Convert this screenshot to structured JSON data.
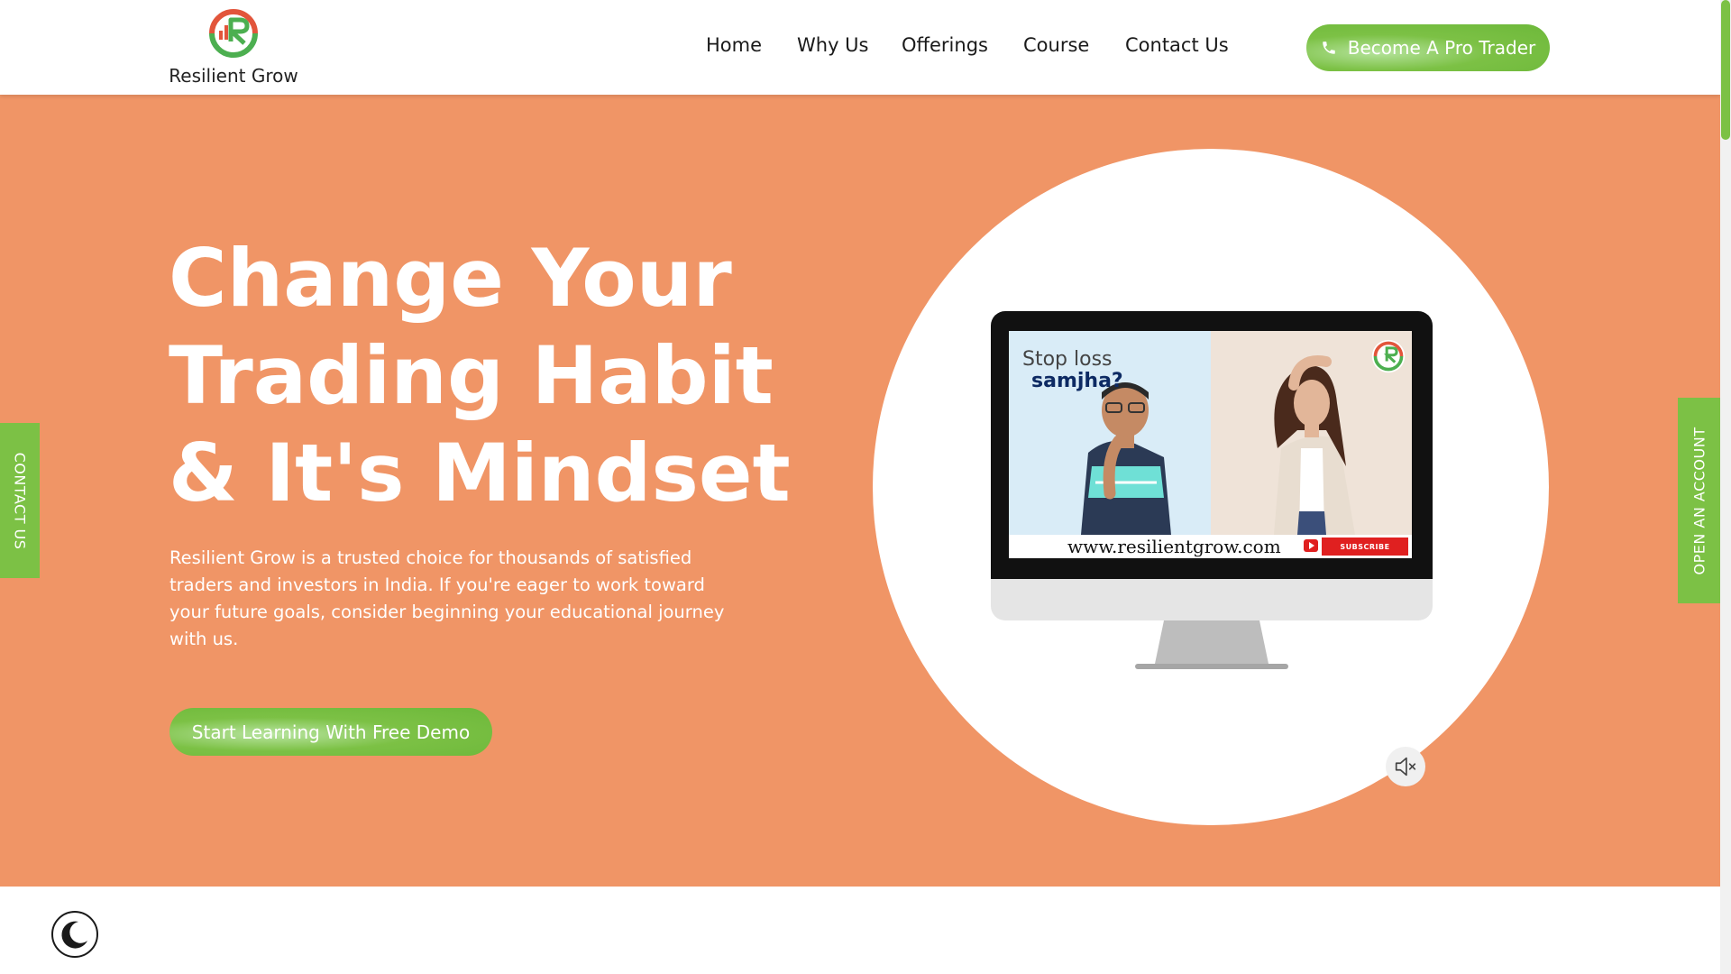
{
  "header": {
    "brand": "Resilient Grow",
    "nav": [
      {
        "label": "Home"
      },
      {
        "label": "Why Us"
      },
      {
        "label": "Offerings"
      },
      {
        "label": "Course"
      },
      {
        "label": "Contact Us"
      }
    ],
    "cta_label": "Become A Pro Trader"
  },
  "hero": {
    "title_lines": [
      "Change Your",
      "Trading Habit",
      "& It's Mindset"
    ],
    "description": "Resilient Grow is a trusted choice for thousands of satisfied traders and investors in India. If you're eager to work toward your future goals, consider beginning your educational journey with us.",
    "cta_label": "Start Learning With Free Demo",
    "video": {
      "caption_line1": "Stop loss",
      "caption_line2": "samjha?",
      "url_text": "www.resilientgrow.com",
      "subscribe_label": "SUBSCRIBE"
    }
  },
  "side_tabs": {
    "left": "CONTACT US",
    "right": "OPEN AN ACCOUNT"
  },
  "icons": {
    "phone": "phone-icon",
    "mute": "speaker-muted-icon",
    "theme": "moon-icon",
    "logo": "resilient-grow-logo-icon"
  },
  "colors": {
    "hero_bg": "#f09566",
    "accent_green": "#7cc145",
    "logo_red": "#e2553b",
    "logo_green": "#4caf50"
  }
}
